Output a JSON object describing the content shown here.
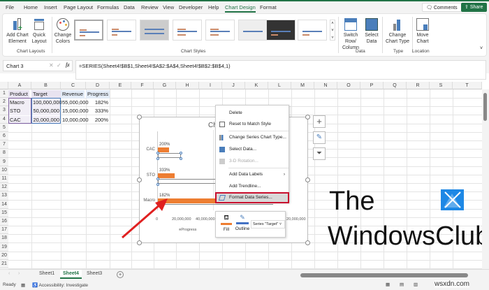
{
  "ribbon_tabs": [
    "File",
    "Home",
    "Insert",
    "Page Layout",
    "Formulas",
    "Data",
    "Review",
    "View",
    "Developer",
    "Help",
    "Chart Design",
    "Format"
  ],
  "active_tab": "Chart Design",
  "header_buttons": {
    "comments": "Comments",
    "share": "Share"
  },
  "ribbon": {
    "add_chart_element": "Add Chart Element",
    "quick_layout": "Quick Layout",
    "chart_layouts_group": "Chart Layouts",
    "change_colors": "Change Colors",
    "chart_styles_group": "Chart Styles",
    "switch_row_column": "Switch Row/ Column",
    "select_data": "Select Data",
    "data_group": "Data",
    "change_chart_type": "Change Chart Type",
    "type_group": "Type",
    "move_chart": "Move Chart",
    "location_group": "Location"
  },
  "name_box": "Chart 3",
  "formula": "=SERIES(Sheet4!$B$1,Sheet4!$A$2:$A$4,Sheet4!$B$2:$B$4,1)",
  "columns": [
    "A",
    "B",
    "C",
    "D",
    "E",
    "F",
    "G",
    "H",
    "I",
    "J",
    "K",
    "L",
    "M",
    "N",
    "O",
    "P",
    "Q",
    "R",
    "S",
    "T"
  ],
  "rows": [
    "1",
    "2",
    "3",
    "4",
    "5",
    "6",
    "7",
    "8",
    "9",
    "10",
    "11",
    "12",
    "13",
    "14",
    "15",
    "16",
    "17",
    "18",
    "19",
    "20",
    "21"
  ],
  "table": {
    "headers": [
      "Product",
      "Target",
      "Revenue",
      "Progress"
    ],
    "rows": [
      [
        "Macro",
        "100,000,000",
        "55,000,000",
        "182%"
      ],
      [
        "STO",
        "50,000,000",
        "15,000,000",
        "333%"
      ],
      [
        "CAC",
        "20,000,000",
        "10,000,000",
        "200%"
      ]
    ]
  },
  "chart": {
    "title_fragment": "Ch",
    "categories": [
      "CAC",
      "STO",
      "Macro"
    ],
    "progress_labels": [
      "200%",
      "333%",
      "182%"
    ],
    "x_ticks": [
      "0",
      "20,000,000",
      "40,000,000",
      "20,000,000"
    ],
    "legend": "Progress",
    "series_color": "#ed7d31"
  },
  "context_menu": [
    "Delete",
    "Reset to Match Style",
    "Change Series Chart Type...",
    "Select Data...",
    "3-D Rotation...",
    "Add Data Labels",
    "Add Trendline...",
    "Format Data Series..."
  ],
  "mini_toolbar": {
    "fill": "Fill",
    "outline": "Outline",
    "series_select": "Series \"Target\""
  },
  "sheets": [
    "Sheet1",
    "Sheet4",
    "Sheet3"
  ],
  "active_sheet": "Sheet4",
  "status": {
    "ready": "Ready",
    "accessibility": "Accessibility: Investigate"
  },
  "watermark": {
    "line1": "The",
    "line2": "WindowsClub",
    "site": "wsxdn.com"
  }
}
